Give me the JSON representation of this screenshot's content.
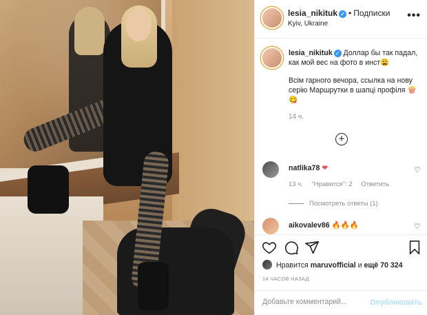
{
  "post": {
    "username": "lesia_nikituk",
    "follow_label": "Подписки",
    "separator": "•",
    "location": "Kyiv, Ukraine",
    "more_label": "•••",
    "caption_line1": "Доллар бы так падал, как мой вес на фото в инст😩",
    "caption_line2": "Всім гарного вечора, ссылка на нову серію Маршрутки в шапці профіля 🍿😋",
    "caption_time": "14 ч.",
    "load_more": "+"
  },
  "comments": [
    {
      "username": "natlika78",
      "text": "❤",
      "time": "13 ч.",
      "likes": "\"Нравится\": 2",
      "reply": "Ответить",
      "view_replies": "Посмотреть ответы (1)"
    },
    {
      "username": "aikovalev86",
      "text": "🔥🔥🔥"
    }
  ],
  "actions": {
    "liked_by_prefix": "Нравится",
    "liked_by_user": "maruvofficial",
    "liked_by_and": "и",
    "liked_by_count": "ещё 70 324",
    "timestamp": "14 ЧАСОВ НАЗАД",
    "comment_placeholder": "Добавьте комментарий...",
    "publish_label": "Опубликовать"
  },
  "colors": {
    "verified": "#3897f0",
    "publish": "#b2dffc",
    "muted": "#8e8e8e"
  }
}
